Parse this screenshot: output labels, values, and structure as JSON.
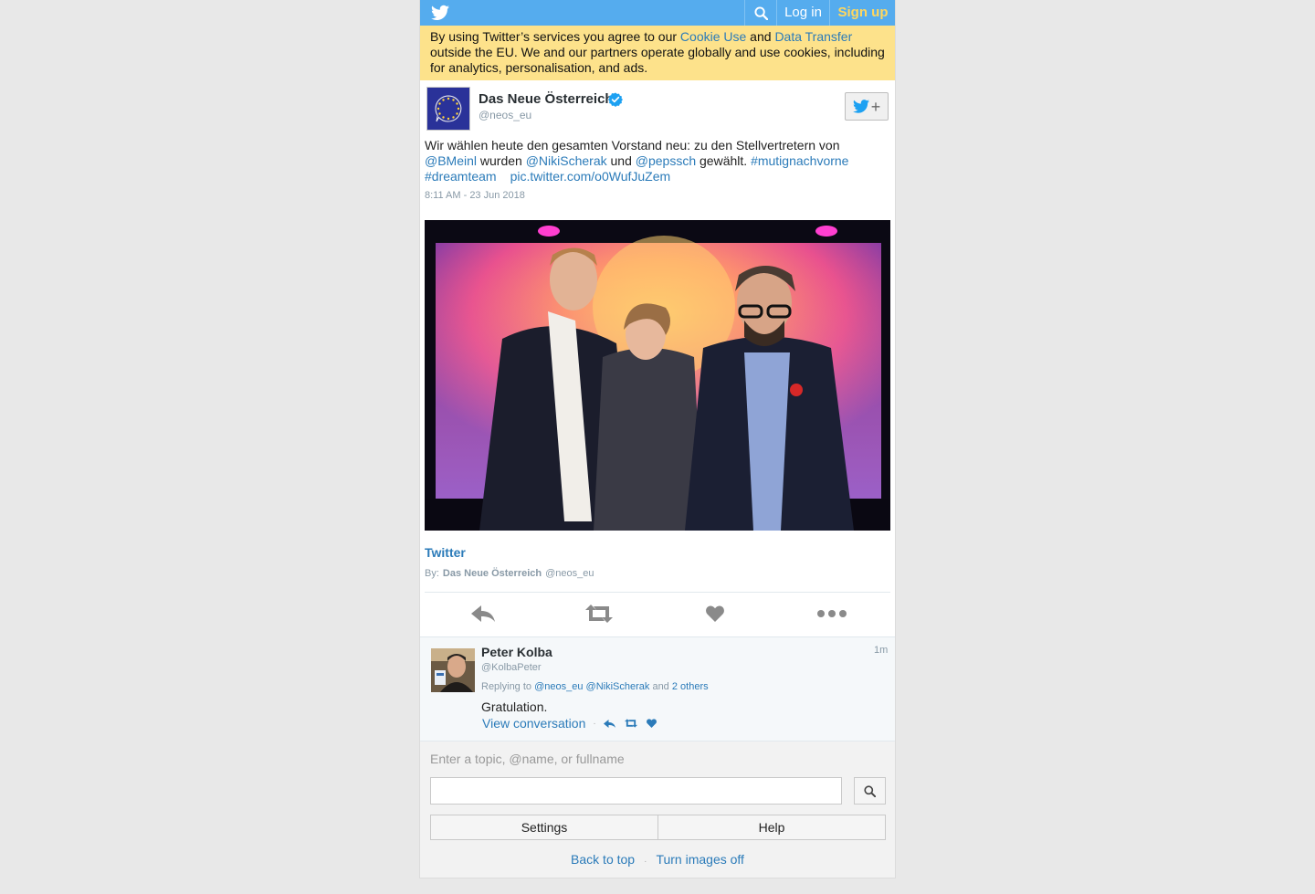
{
  "topbar": {
    "login_label": "Log in",
    "signup_label": "Sign up"
  },
  "cookie": {
    "text_1": "By using Twitter’s services you agree to our ",
    "link_cookie": "Cookie Use",
    "text_2": " and ",
    "link_transfer": "Data Transfer",
    "text_3": " outside the EU. We and our partners operate globally and use cookies, including for analytics, personalisation, and ads."
  },
  "tweet": {
    "author_name": "Das Neue Österreich",
    "author_handle": "@neos_eu",
    "text_1": "Wir wählen heute den gesamten Vorstand neu: zu den Stellvertretern von ",
    "mention_1": "@BMeinl",
    "text_2": " wurden ",
    "mention_2": "@NikiScherak",
    "text_3": " und ",
    "mention_3": "@pepssch",
    "text_4": " gewählt. ",
    "hashtag_1": "#mutignachvorne",
    "hashtag_2": "#dreamteam",
    "pic_link": "pic.twitter.com/o0WufJuZem",
    "timestamp": "8:11 AM - 23 Jun 2018",
    "card_title": "Twitter",
    "card_by_label": "By:",
    "card_by_name": "Das Neue Österreich",
    "card_by_handle": "@neos_eu"
  },
  "reply": {
    "name": "Peter Kolba",
    "handle": "@KolbaPeter",
    "time": "1m",
    "replying_label": "Replying to ",
    "replying_1": "@neos_eu",
    "replying_2": "@NikiScherak",
    "replying_and": " and ",
    "replying_others": "2 others",
    "text": "Gratulation.",
    "view_conversation": "View conversation"
  },
  "footer": {
    "search_label": "Enter a topic, @name, or fullname",
    "settings_label": "Settings",
    "help_label": "Help",
    "back_to_top": "Back to top",
    "turn_images_off": "Turn images off"
  },
  "colors": {
    "brand": "#55acee",
    "link": "#2b7bb9",
    "cookie_bg": "#fde28b",
    "signup": "#ffd75e"
  }
}
